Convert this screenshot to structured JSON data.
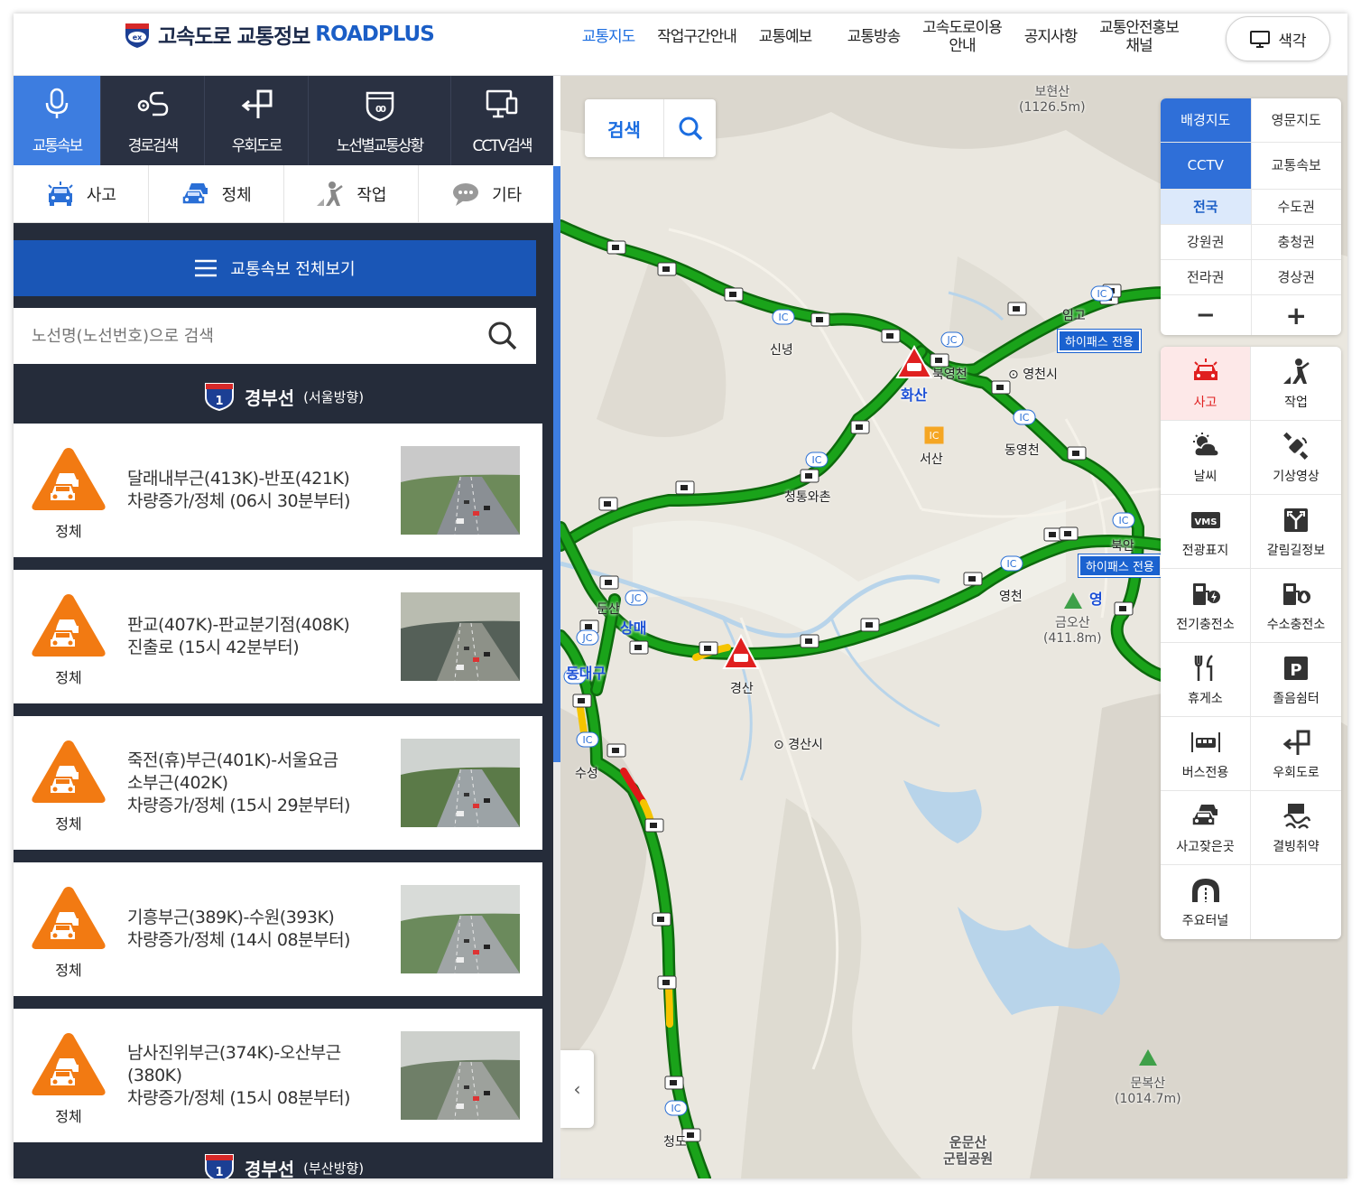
{
  "header": {
    "logo_text": "고속도로 교통정보",
    "logo_brand": "ROADPLUS",
    "nav": [
      {
        "label": "교통지도",
        "active": true
      },
      {
        "label": "작업구간안내"
      },
      {
        "label": "교통예보"
      },
      {
        "label": "교통방송"
      },
      {
        "label": "고속도로이용안내"
      },
      {
        "label": "공지사항"
      },
      {
        "label": "교통안전홍보채널"
      }
    ],
    "color_button": "색각"
  },
  "panel": {
    "tabs": [
      {
        "label": "교통속보",
        "icon": "mic-icon",
        "active": true
      },
      {
        "label": "경로검색",
        "icon": "route-icon"
      },
      {
        "label": "우회도로",
        "icon": "detour-icon"
      },
      {
        "label": "노선별교통상황",
        "icon": "highway-shield-icon"
      },
      {
        "label": "CCTV검색",
        "icon": "monitor-icon"
      }
    ],
    "subtabs": [
      {
        "label": "사고",
        "icon": "accident-car-icon"
      },
      {
        "label": "정체",
        "icon": "congestion-car-icon"
      },
      {
        "label": "작업",
        "icon": "worker-icon"
      },
      {
        "label": "기타",
        "icon": "chat-bubble-icon"
      }
    ],
    "view_all": "교통속보 전체보기",
    "search_placeholder": "노선명(노선번호)으로 검색",
    "route1": {
      "number": "1",
      "name": "경부선",
      "direction": "(서울방향)"
    },
    "route2": {
      "number": "1",
      "name": "경부선",
      "direction": "(부산방향)"
    },
    "items": [
      {
        "type": "정체",
        "lines": [
          "달래내부근(413K)-반포(421K)",
          "차량증가/정체 (06시 30분부터)"
        ]
      },
      {
        "type": "정체",
        "lines": [
          "판교(407K)-판교분기점(408K)",
          "진출로 (15시 42분부터)"
        ]
      },
      {
        "type": "정체",
        "lines": [
          "죽전(휴)부근(401K)-서울요금",
          "소부근(402K)",
          "차량증가/정체 (15시 29분부터)"
        ]
      },
      {
        "type": "정체",
        "lines": [
          "기흥부근(389K)-수원(393K)",
          "차량증가/정체 (14시 08분부터)"
        ]
      },
      {
        "type": "정체",
        "lines": [
          "남사진위부근(374K)-오산부근",
          "(380K)",
          "차량증가/정체 (15시 08분부터)"
        ]
      }
    ]
  },
  "map": {
    "search_label": "검색",
    "controls": {
      "row1": [
        "배경지도",
        "영문지도"
      ],
      "row2": [
        "CCTV",
        "교통속보"
      ],
      "regions": [
        "전국",
        "수도권",
        "강원권",
        "충청권",
        "전라권",
        "경상권"
      ],
      "zoom_out": "−",
      "zoom_in": "+"
    },
    "layers": [
      {
        "label": "사고",
        "icon": "accident-icon",
        "on": true
      },
      {
        "label": "작업",
        "icon": "construction-icon"
      },
      {
        "label": "날씨",
        "icon": "weather-icon"
      },
      {
        "label": "기상영상",
        "icon": "satellite-icon"
      },
      {
        "label": "전광표지",
        "icon": "vms-icon"
      },
      {
        "label": "갈림길정보",
        "icon": "junction-icon"
      },
      {
        "label": "전기충전소",
        "icon": "ev-charger-icon"
      },
      {
        "label": "수소충전소",
        "icon": "hydrogen-icon"
      },
      {
        "label": "휴게소",
        "icon": "rest-area-icon"
      },
      {
        "label": "졸음쉼터",
        "icon": "parking-icon"
      },
      {
        "label": "버스전용",
        "icon": "bus-lane-icon"
      },
      {
        "label": "우회도로",
        "icon": "detour-icon"
      },
      {
        "label": "사고잦은곳",
        "icon": "accident-prone-icon"
      },
      {
        "label": "결빙취약",
        "icon": "icy-road-icon"
      },
      {
        "label": "주요터널",
        "icon": "tunnel-icon"
      }
    ],
    "place_labels": {
      "bohyeonsan": "보현산",
      "bohyeonsan_alt": "(1126.5m)",
      "sinnyeong": "신녕",
      "hwasan": "화산",
      "bukyeongcheon": "북영천",
      "yeongcheonsi": "영천시",
      "seosan": "서산",
      "dongyeongcheon": "동영천",
      "cheongtong": "청통와촌",
      "bukan": "북안",
      "yeongcheon": "영천",
      "geumosan": "금오산",
      "geumosan_alt": "(411.8m)",
      "dunsan": "둔산",
      "sangmae": "상매",
      "dongdaegu": "동대구",
      "gyeongsan": "경산",
      "gyeongsansi": "경산시",
      "suseong": "수성",
      "cheongdo": "청도",
      "imgo": "임고",
      "munboksan": "문복산",
      "munboksan_alt": "(1014.7m)",
      "unmunsan": "운문산",
      "unmunsan_park": "군립공원",
      "hipass1": "하이패스 전용",
      "hipass2": "하이패스 전용",
      "yeong_partial": "영"
    }
  },
  "colors": {
    "accent": "#1b6de0",
    "panel_bg": "#252c3a",
    "view_all_bg": "#1a56b6",
    "road_green": "#1aa31a",
    "congestion_orange": "#f07a10",
    "accident_red": "#e02020"
  }
}
